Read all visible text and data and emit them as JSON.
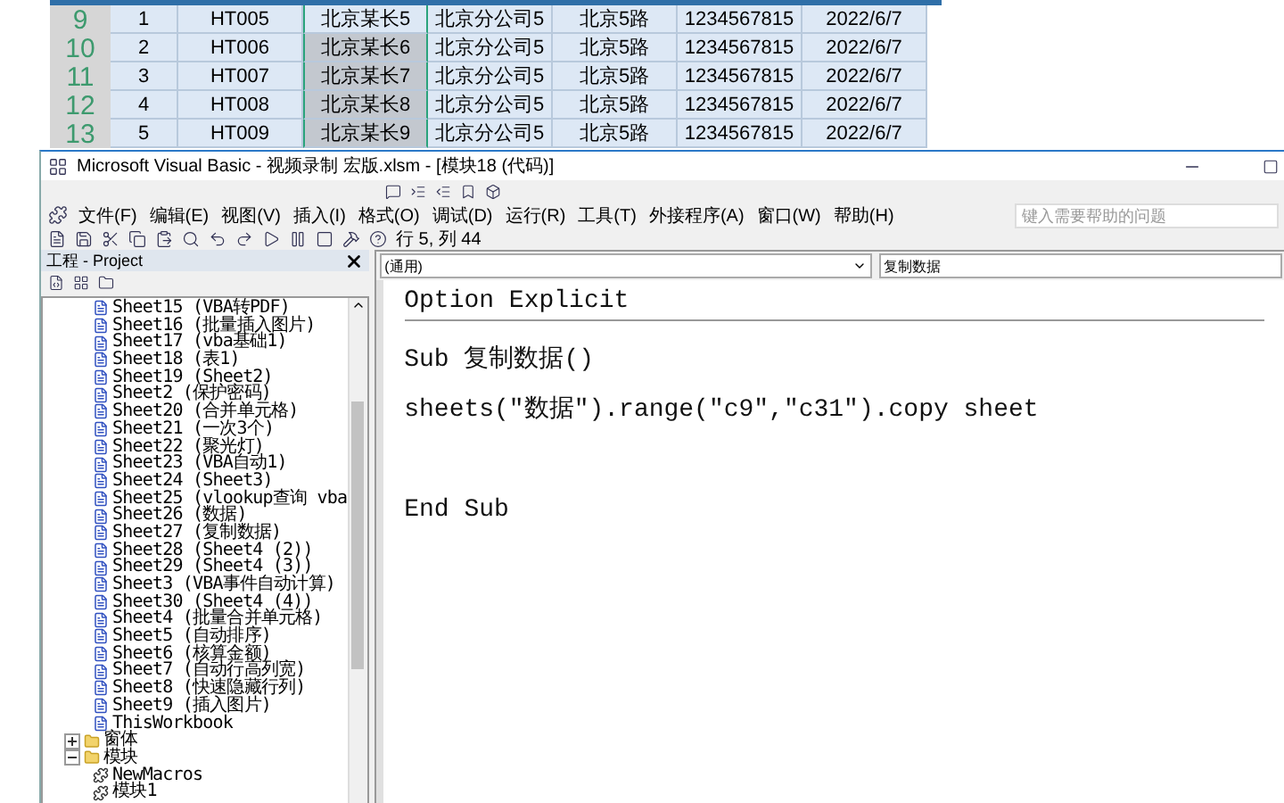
{
  "sheet": {
    "rows": [
      {
        "header": "9",
        "cells": [
          "1",
          "HT005",
          "北京某长5",
          "北京分公司5",
          "北京5路",
          "1234567815",
          "2022/6/7"
        ],
        "selected": false
      },
      {
        "header": "10",
        "cells": [
          "2",
          "HT006",
          "北京某长6",
          "北京分公司5",
          "北京5路",
          "1234567815",
          "2022/6/7"
        ],
        "selected": true
      },
      {
        "header": "11",
        "cells": [
          "3",
          "HT007",
          "北京某长7",
          "北京分公司5",
          "北京5路",
          "1234567815",
          "2022/6/7"
        ],
        "selected": true
      },
      {
        "header": "12",
        "cells": [
          "4",
          "HT008",
          "北京某长8",
          "北京分公司5",
          "北京5路",
          "1234567815",
          "2022/6/7"
        ],
        "selected": true
      },
      {
        "header": "13",
        "cells": [
          "5",
          "HT009",
          "北京某长9",
          "北京分公司5",
          "北京5路",
          "1234567815",
          "2022/6/7"
        ],
        "selected": true
      }
    ]
  },
  "window": {
    "title": "Microsoft Visual Basic - 视频录制 宏版.xlsm - [模块18 (代码)]"
  },
  "menu": [
    "文件(F)",
    "编辑(E)",
    "视图(V)",
    "插入(I)",
    "格式(O)",
    "调试(D)",
    "运行(R)",
    "工具(T)",
    "外接程序(A)",
    "窗口(W)",
    "帮助(H)"
  ],
  "help_search": {
    "placeholder": "键入需要帮助的问题"
  },
  "toolbar": {
    "position": "行 5, 列 44"
  },
  "project": {
    "title": "工程 - Project",
    "excel_objects": [
      "Sheet15 (VBA转PDF)",
      "Sheet16 (批量插入图片)",
      "Sheet17 (vba基础1)",
      "Sheet18 (表1)",
      "Sheet19 (Sheet2)",
      "Sheet2 (保护密码)",
      "Sheet20 (合并单元格)",
      "Sheet21 (一次3个)",
      "Sheet22 (聚光灯)",
      "Sheet23 (VBA自动1)",
      "Sheet24 (Sheet3)",
      "Sheet25 (vlookup查询 vba",
      "Sheet26 (数据)",
      "Sheet27 (复制数据)",
      "Sheet28 (Sheet4 (2))",
      "Sheet29 (Sheet4 (3))",
      "Sheet3 (VBA事件自动计算)",
      "Sheet30 (Sheet4 (4))",
      "Sheet4 (批量合并单元格)",
      "Sheet5 (自动排序)",
      "Sheet6 (核算金额)",
      "Sheet7 (自动行高列宽)",
      "Sheet8 (快速隐藏行列)",
      "Sheet9 (插入图片)",
      "ThisWorkbook"
    ],
    "folders": [
      {
        "label": "窗体",
        "expanded": false
      },
      {
        "label": "模块",
        "expanded": true,
        "children": [
          "NewMacros",
          "模块1"
        ]
      }
    ]
  },
  "code": {
    "object": "(通用)",
    "procedure": "复制数据",
    "lines": [
      "Option Explicit",
      "Sub 复制数据()",
      "sheets(\"数据\").range(\"c9\",\"c31\").copy sheet",
      "End Sub"
    ]
  }
}
